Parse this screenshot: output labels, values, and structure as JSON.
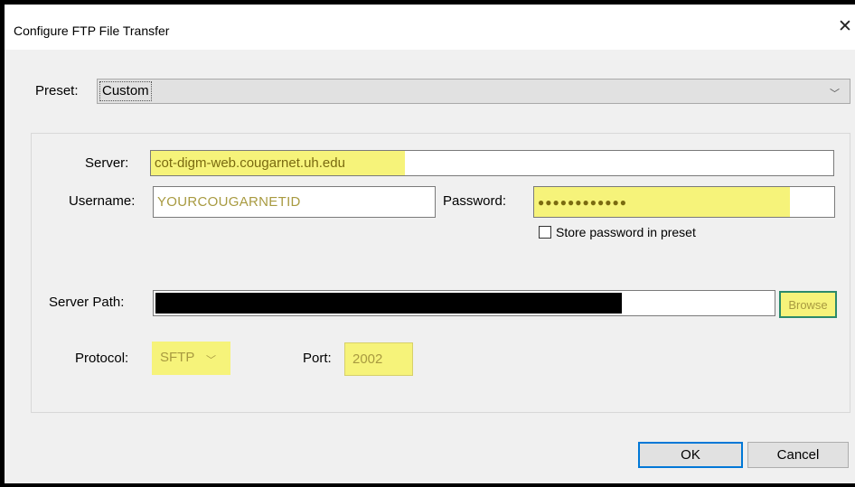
{
  "dialog": {
    "title": "Configure FTP File Transfer",
    "close_glyph": "✕"
  },
  "preset": {
    "label": "Preset:",
    "value": "Custom",
    "chevron": "﹀"
  },
  "server": {
    "label": "Server:",
    "value": "cot-digm-web.cougarnet.uh.edu"
  },
  "username": {
    "label": "Username:",
    "value": "YOURCOUGARNETID"
  },
  "password": {
    "label": "Password:",
    "value": "●●●●●●●●●●●●"
  },
  "store_password": {
    "label": "Store password in preset",
    "checked": false
  },
  "server_path": {
    "label": "Server Path:",
    "browse_label": "Browse"
  },
  "protocol": {
    "label": "Protocol:",
    "value": "SFTP",
    "chevron": "﹀"
  },
  "port": {
    "label": "Port:",
    "value": "2002"
  },
  "buttons": {
    "ok": "OK",
    "cancel": "Cancel"
  },
  "icons": {
    "close": "close-icon",
    "dropdown": "chevron-down-icon"
  },
  "colors": {
    "highlight": "#f6f37a",
    "focus_border": "#0078d7"
  }
}
